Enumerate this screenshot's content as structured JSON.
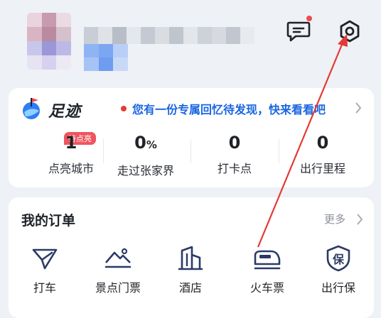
{
  "header": {
    "message_icon": "message-icon",
    "settings_icon": "settings-gear-icon"
  },
  "footprint": {
    "title": "足迹",
    "promo_text": "您有一份专属回忆待发现，快来看看吧",
    "stats": [
      {
        "value": "1",
        "label": "点亮城市",
        "tag": "待点亮"
      },
      {
        "value": "0",
        "unit": "%",
        "label": "走过张家界"
      },
      {
        "value": "0",
        "label": "打卡点"
      },
      {
        "value": "0",
        "label": "出行里程"
      }
    ]
  },
  "orders": {
    "title": "我的订单",
    "more": "更多",
    "items": [
      {
        "label": "打车",
        "icon": "taxi-icon"
      },
      {
        "label": "景点门票",
        "icon": "scenic-ticket-icon"
      },
      {
        "label": "酒店",
        "icon": "hotel-icon"
      },
      {
        "label": "火车票",
        "icon": "train-icon"
      },
      {
        "label": "出行保",
        "icon": "insurance-icon"
      }
    ]
  },
  "colors": {
    "accent_blue": "#1a66e0",
    "annotation_red": "#e53935",
    "icon_navy": "#2b3a67"
  }
}
